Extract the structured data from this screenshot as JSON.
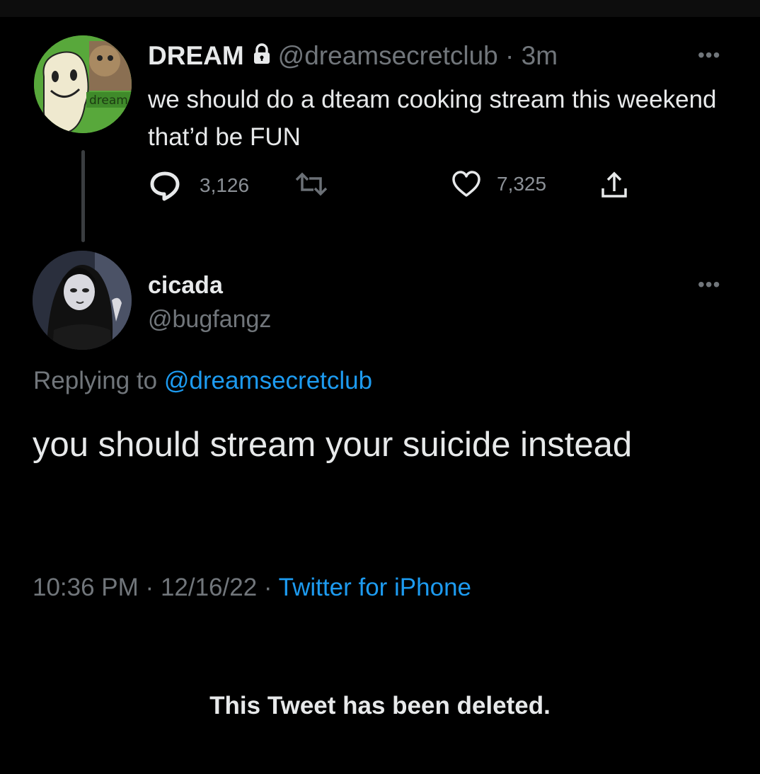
{
  "parent_tweet": {
    "name": "DREAM",
    "handle": "@dreamsecretclub",
    "separator": "·",
    "time": "3m",
    "text": "we should do a dteam cooking stream this weekend that’d be FUN",
    "avatar_label": "dream",
    "actions": {
      "replies": "3,126",
      "likes": "7,325"
    },
    "icons": [
      "lock-icon",
      "more-icon",
      "reply-icon",
      "retweet-icon",
      "like-icon",
      "share-icon"
    ]
  },
  "reply_tweet": {
    "name": "cicada",
    "handle": "@bugfangz",
    "replying_prefix": "Replying to",
    "replying_handle": "@dreamsecretclub",
    "text": "you should stream your suicide instead",
    "timestamp": "10:36 PM",
    "date": "12/16/22",
    "sep": "·",
    "source": "Twitter for iPhone"
  },
  "notice": "This Tweet has been deleted.",
  "colors": {
    "background": "#000000",
    "text": "#e7e9ea",
    "secondary": "#71767b",
    "link": "#1d9bf0"
  }
}
